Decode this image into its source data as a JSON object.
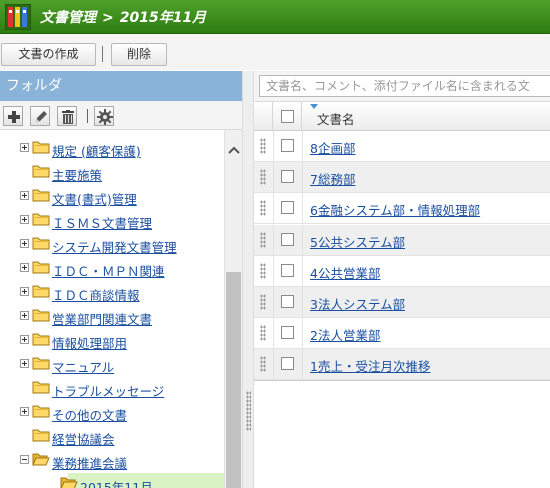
{
  "header": {
    "app_name": "文書管理",
    "separator": ">",
    "current_folder": "2015年11月",
    "accent_color": "#3a8a1c"
  },
  "toolbar": {
    "create_label": "文書の作成",
    "divider": "|",
    "delete_label": "削除"
  },
  "left_panel": {
    "title": "フォルダ",
    "tools": [
      "add-icon",
      "edit-icon",
      "trash-icon",
      "gear-icon"
    ],
    "tree": [
      {
        "label": "規定 (顧客保護)",
        "toggle": "plus",
        "indent": 1,
        "state": "closed"
      },
      {
        "label": "主要施策",
        "toggle": "none",
        "indent": 1,
        "state": "closed"
      },
      {
        "label": "文書(書式)管理",
        "toggle": "plus",
        "indent": 1,
        "state": "closed"
      },
      {
        "label": "ＩＳＭＳ文書管理",
        "toggle": "plus",
        "indent": 1,
        "state": "closed"
      },
      {
        "label": "システム開発文書管理",
        "toggle": "plus",
        "indent": 1,
        "state": "closed"
      },
      {
        "label": "ＩＤＣ・ＭＰＮ関連",
        "toggle": "plus",
        "indent": 1,
        "state": "closed"
      },
      {
        "label": "ＩＤＣ商談情報",
        "toggle": "plus",
        "indent": 1,
        "state": "closed"
      },
      {
        "label": "営業部門関連文書",
        "toggle": "plus",
        "indent": 1,
        "state": "closed"
      },
      {
        "label": "情報処理部用",
        "toggle": "plus",
        "indent": 1,
        "state": "closed"
      },
      {
        "label": "マニュアル",
        "toggle": "plus",
        "indent": 1,
        "state": "closed"
      },
      {
        "label": "トラブルメッセージ",
        "toggle": "none",
        "indent": 1,
        "state": "closed"
      },
      {
        "label": "その他の文書",
        "toggle": "plus",
        "indent": 1,
        "state": "closed"
      },
      {
        "label": "経営協議会",
        "toggle": "none",
        "indent": 1,
        "state": "closed"
      },
      {
        "label": "業務推進会議",
        "toggle": "minus",
        "indent": 1,
        "state": "open"
      },
      {
        "label": "2015年11月",
        "toggle": "none",
        "indent": 2,
        "state": "open",
        "selected": true
      }
    ]
  },
  "right_panel": {
    "search_placeholder": "文書名、コメント、添付ファイル名に含まれる文",
    "column_title": "文書名",
    "documents": [
      "8企画部",
      "7総務部",
      "6金融システム部・情報処理部",
      "5公共システム部",
      "4公共営業部",
      "3法人システム部",
      "2法人営業部",
      "1売上・受注月次推移"
    ]
  }
}
